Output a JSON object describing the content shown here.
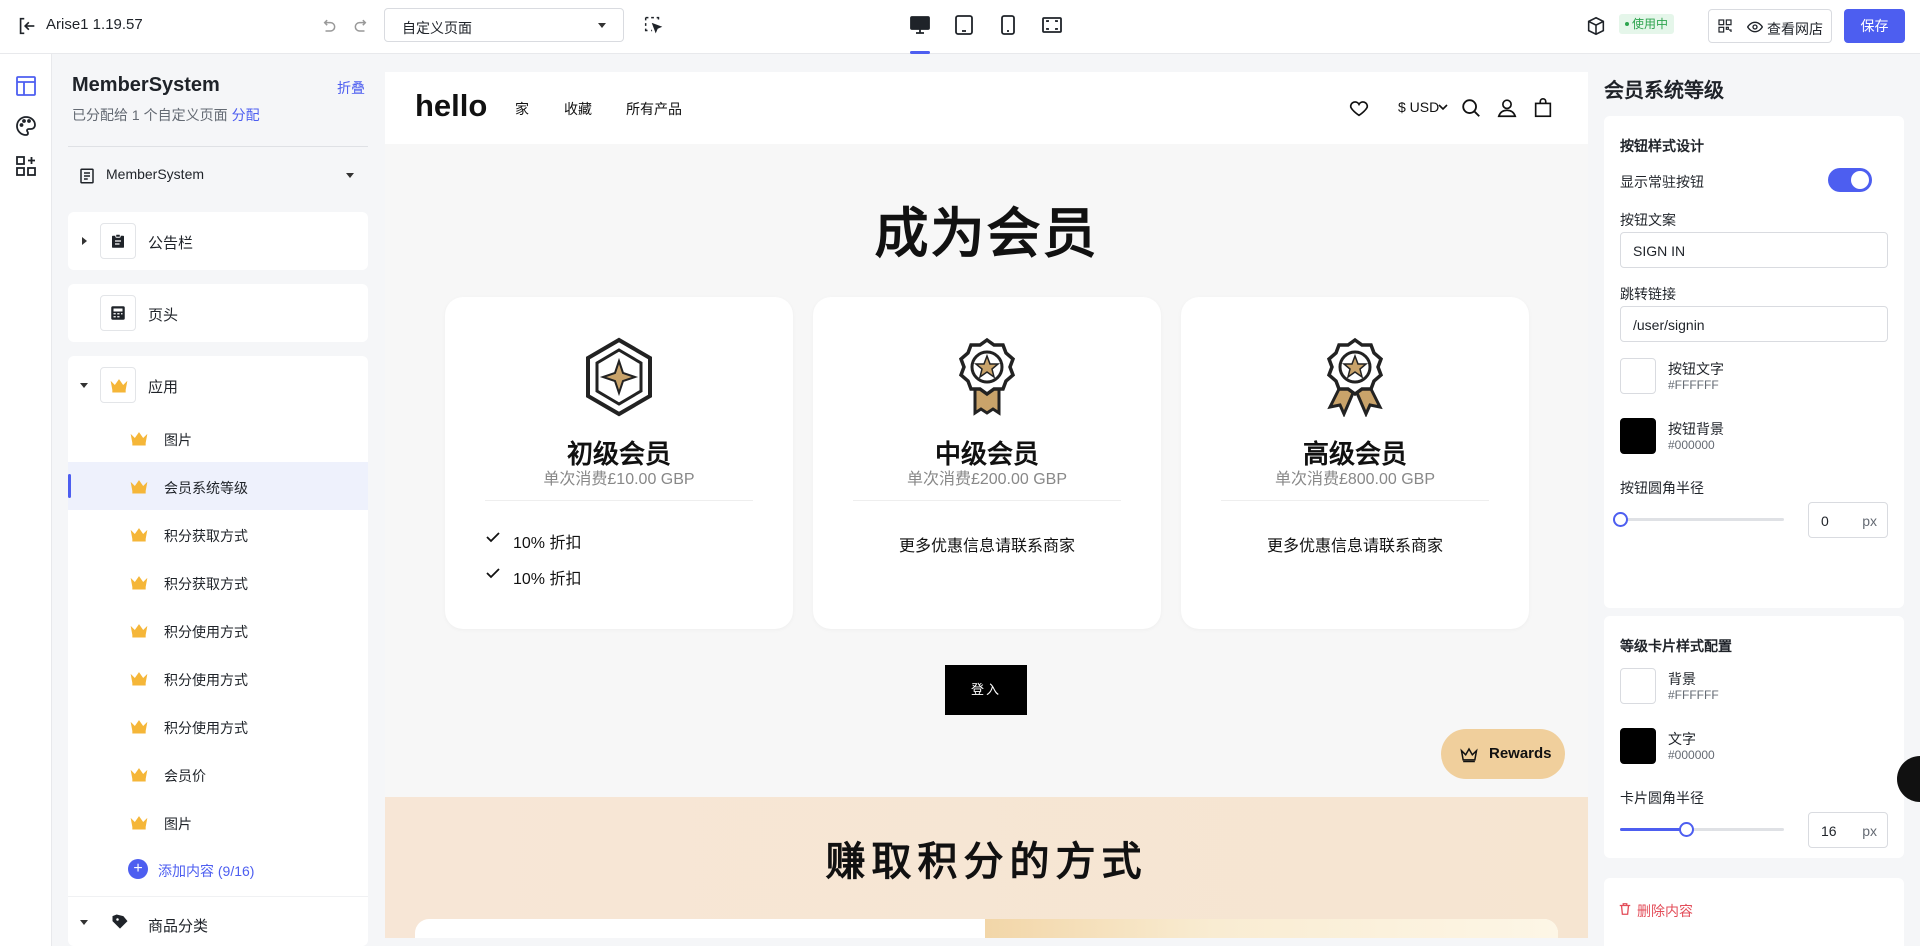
{
  "app": {
    "title": "Arise1 1.19.57"
  },
  "topbar": {
    "page_select": "自定义页面",
    "status": "使用中",
    "view_store": "查看网店",
    "save": "保存"
  },
  "left": {
    "title": "MemberSystem",
    "fold": "折叠",
    "subtitle": "已分配给 1 个自定义页面",
    "assign": "分配",
    "page_name": "MemberSystem",
    "sections": {
      "announcement": "公告栏",
      "header": "页头",
      "apps": "应用",
      "category": "商品分类"
    },
    "app_items": [
      {
        "label": "图片"
      },
      {
        "label": "会员系统等级"
      },
      {
        "label": "积分获取方式"
      },
      {
        "label": "积分获取方式"
      },
      {
        "label": "积分使用方式"
      },
      {
        "label": "积分使用方式"
      },
      {
        "label": "积分使用方式"
      },
      {
        "label": "会员价"
      },
      {
        "label": "图片"
      }
    ],
    "add_content": "添加内容 (9/16)"
  },
  "store": {
    "logo": "hello",
    "nav": [
      "家",
      "收藏",
      "所有产品"
    ],
    "currency": "$ USD",
    "hero_title": "成为会员",
    "tiers": [
      {
        "name": "初级会员",
        "condition": "单次消费£10.00 GBP",
        "benefits": [
          "10% 折扣",
          "10% 折扣"
        ],
        "more": ""
      },
      {
        "name": "中级会员",
        "condition": "单次消费£200.00 GBP",
        "benefits": [],
        "more": "更多优惠信息请联系商家"
      },
      {
        "name": "高级会员",
        "condition": "单次消费£800.00 GBP",
        "benefits": [],
        "more": "更多优惠信息请联系商家"
      }
    ],
    "signin_button": "登入",
    "rewards": "Rewards",
    "earn_title": "赚取积分的方式"
  },
  "right": {
    "title": "会员系统等级",
    "button_design": {
      "heading": "按钮样式设计",
      "show_sticky": "显示常驻按钮",
      "text_label": "按钮文案",
      "text_value": "SIGN IN",
      "link_label": "跳转链接",
      "link_value": "/user/signin",
      "text_color_name": "按钮文字",
      "text_color_hex": "#FFFFFF",
      "bg_color_name": "按钮背景",
      "bg_color_hex": "#000000",
      "radius_label": "按钮圆角半径",
      "radius_value": "0",
      "unit": "px"
    },
    "card_style": {
      "heading": "等级卡片样式配置",
      "bg_name": "背景",
      "bg_hex": "#FFFFFF",
      "text_name": "文字",
      "text_hex": "#000000",
      "radius_label": "卡片圆角半径",
      "radius_value": "16",
      "radius_fraction": 0.4,
      "unit": "px"
    },
    "delete": "删除内容"
  },
  "colors": {
    "accent": "#4d5ef0",
    "gold": "#c9a36a",
    "danger": "#e34d59"
  }
}
